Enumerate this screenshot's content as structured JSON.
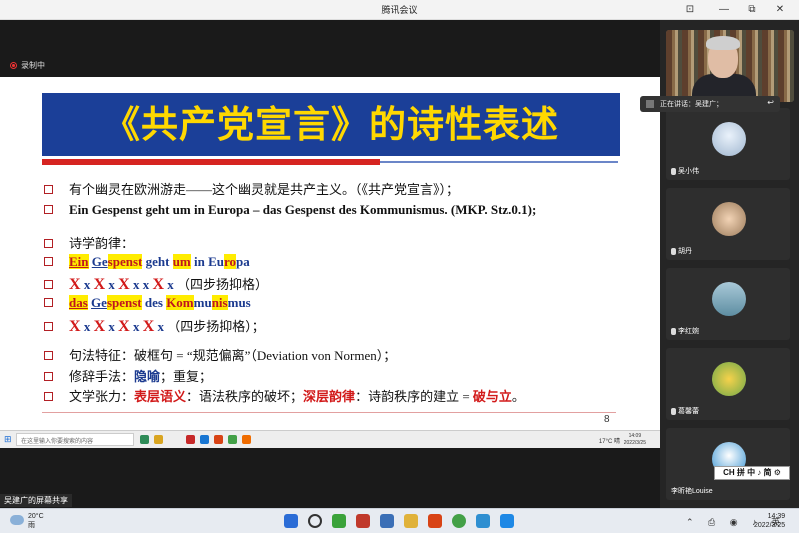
{
  "window": {
    "title": "腾讯会议",
    "minimize": "—",
    "maximize": "☐",
    "restore": "⧉",
    "close": "✕",
    "pin": "⊡"
  },
  "recording": {
    "label": "录制中"
  },
  "slide": {
    "title": "《共产党宣言》的诗性表述",
    "lines": {
      "l1": "有个幽灵在欧洲游走——这个幽灵就是共产主义。（《共产党宣言》）；",
      "l2": "Ein Gespenst geht um in Europa – das Gespenst des Kommunismus. (MKP. Stz.0.1);",
      "l3": "诗学韵律：",
      "l4": {
        "ein": "Ein",
        "ge": "Ge",
        "spenst": "spenst",
        "geht": "geht",
        "um": "um",
        "in": "in",
        "eu": "Eu",
        "ro": "ro",
        "pa": "pa"
      },
      "l5": {
        "X": "X",
        "x": "x",
        "note": "（四步扬抑格）"
      },
      "l6": {
        "das": "das",
        "ge": "Ge",
        "spenst": "spenst",
        "des": "des",
        "kom": "Kom",
        "mu": "mu",
        "nis": "nis",
        "mus": "mus"
      },
      "l7": {
        "note": "（四步扬抑格）；"
      },
      "l8": "句法特征：破框句 = “规范偏离”（Deviation von Normen）；",
      "l9": {
        "a": "修辞手法：",
        "b": "隐喻",
        "c": "；重复；"
      },
      "l10": {
        "a": "文学张力：",
        "b": "表层语义",
        "c": "：语法秩序的破坏；",
        "d": "深层韵律",
        "e": "：诗韵秩序的建立 = ",
        "f": "破与立",
        "g": "。"
      }
    },
    "page_number": "8"
  },
  "slide_taskbar": {
    "search_placeholder": "在这里输入你要搜索的内容",
    "weather": "17°C 晴",
    "time": "14:09",
    "date": "2022/3/25"
  },
  "share_label": "吴建广的屏幕共享",
  "speaking": {
    "label": "正在讲话：吴建广；"
  },
  "participants": [
    {
      "name": "吴小伟"
    },
    {
      "name": "胡丹"
    },
    {
      "name": "李红婉"
    },
    {
      "name": "葛馨蕾"
    },
    {
      "name": "李昕艳Louise"
    }
  ],
  "ime_bar": "CH 拼 中 ♪ 简 ⚙",
  "taskbar": {
    "weather_temp": "20°C",
    "weather_desc": "雨",
    "tray": "⌃ ⎙ ◉ ♪ 英",
    "time": "14:39",
    "date": "2022/3/25"
  },
  "colors": {
    "banner_bg": "#1b3f98",
    "banner_text": "#ffd800",
    "accent_red": "#d21a1a",
    "highlight": "#ffec00"
  }
}
